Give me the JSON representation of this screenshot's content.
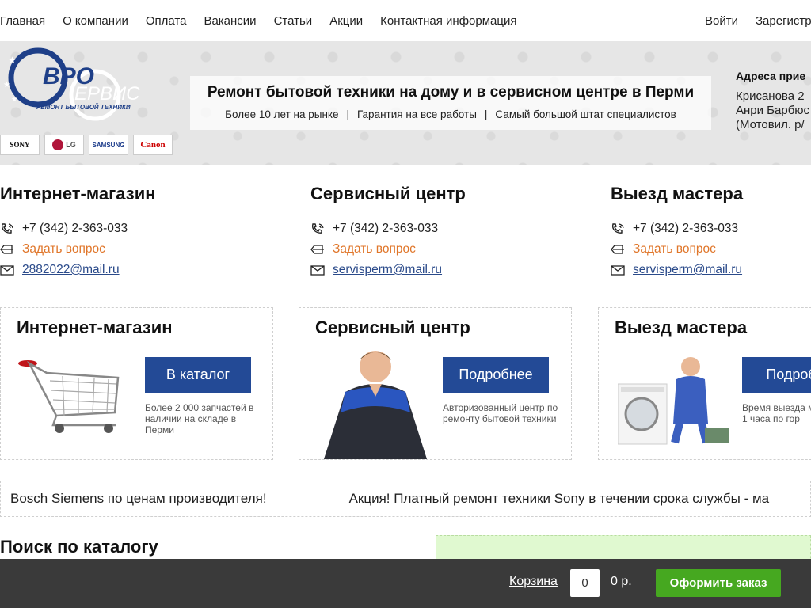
{
  "nav": {
    "items": [
      "Главная",
      "О компании",
      "Оплата",
      "Вакансии",
      "Статьи",
      "Акции",
      "Контактная информация"
    ],
    "login": "Войти",
    "register": "Зарегистр"
  },
  "banner": {
    "logo_text": "ЕВРО СЕРВИС",
    "logo_sub": "РЕМОНТ БЫТОВОЙ ТЕХНИКИ",
    "brands": [
      "SONY",
      "LG",
      "SAMSUNG",
      "Canon"
    ],
    "title": "Ремонт бытовой техники на дому и в сервисном центре в Перми",
    "features": [
      "Более 10 лет на рынке",
      "Гарантия на все работы",
      "Самый большой штат специалистов"
    ],
    "address_heading": "Адреса прие",
    "address_lines": [
      "Крисанова 2",
      "Анри Барбюс",
      "(Мотовил. р/"
    ]
  },
  "contacts": [
    {
      "title": "Интернет-магазин",
      "phone": "+7 (342) 2-363-033",
      "ask": "Задать вопрос",
      "email": "2882022@mail.ru"
    },
    {
      "title": "Сервисный центр",
      "phone": "+7 (342) 2-363-033",
      "ask": "Задать вопрос",
      "email": "servisperm@mail.ru"
    },
    {
      "title": "Выезд мастера",
      "phone": "+7 (342) 2-363-033",
      "ask": "Задать вопрос",
      "email": "servisperm@mail.ru"
    }
  ],
  "cards": [
    {
      "title": "Интернет-магазин",
      "button": "В каталог",
      "note": "Более 2 000 запчастей в наличии на складе в Перми"
    },
    {
      "title": "Сервисный центр",
      "button": "Подробнее",
      "note": "Авторизованный центр по ремонту бытовой техники"
    },
    {
      "title": "Выезд мастера",
      "button": "Подробн",
      "note": "Время выезда м от 1 часа по гор"
    }
  ],
  "ticker": {
    "link": "Bosch Siemens по ценам производителя!",
    "text": "Акция! Платный ремонт техники Sony в течении срока службы - ма"
  },
  "search": {
    "title": "Поиск по каталогу"
  },
  "cart": {
    "label": "Корзина",
    "qty": "0",
    "sum": "0 р.",
    "order": "Оформить заказ"
  },
  "colors": {
    "accent_blue": "#234a96",
    "ask_orange": "#e0762a",
    "order_green": "#46a820",
    "bar_dark": "#3a3a3a"
  }
}
